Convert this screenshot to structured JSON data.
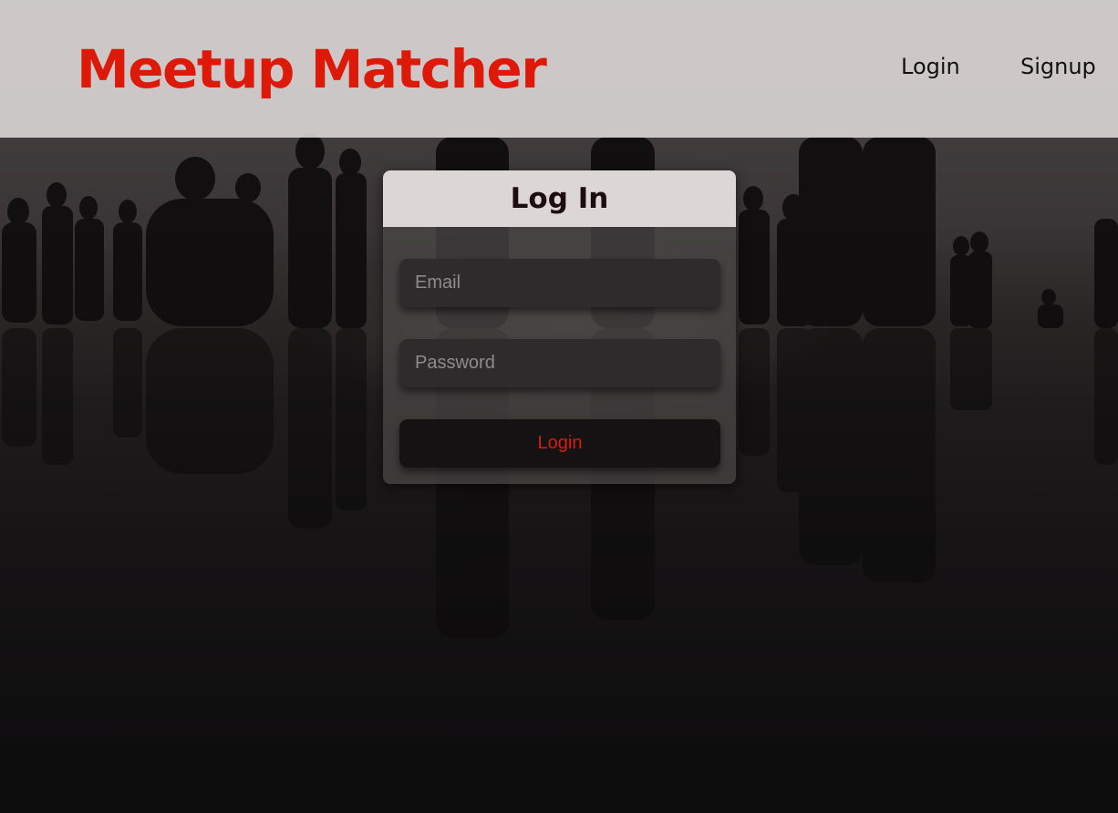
{
  "header": {
    "brand": "Meetup Matcher",
    "nav": {
      "login": "Login",
      "signup": "Signup"
    }
  },
  "login_card": {
    "title": "Log In",
    "email_placeholder": "Email",
    "password_placeholder": "Password",
    "submit_label": "Login"
  },
  "colors": {
    "brand": "#dd1a0a",
    "header_bg": "#dcd6d6",
    "card_title": "#1e0d0d",
    "field_bg": "#2d2b2c",
    "button_bg": "#141213",
    "page_bg": "#0d0c0d"
  },
  "background_image": "silhouettes-of-people-on-reflective-beach-at-dusk"
}
